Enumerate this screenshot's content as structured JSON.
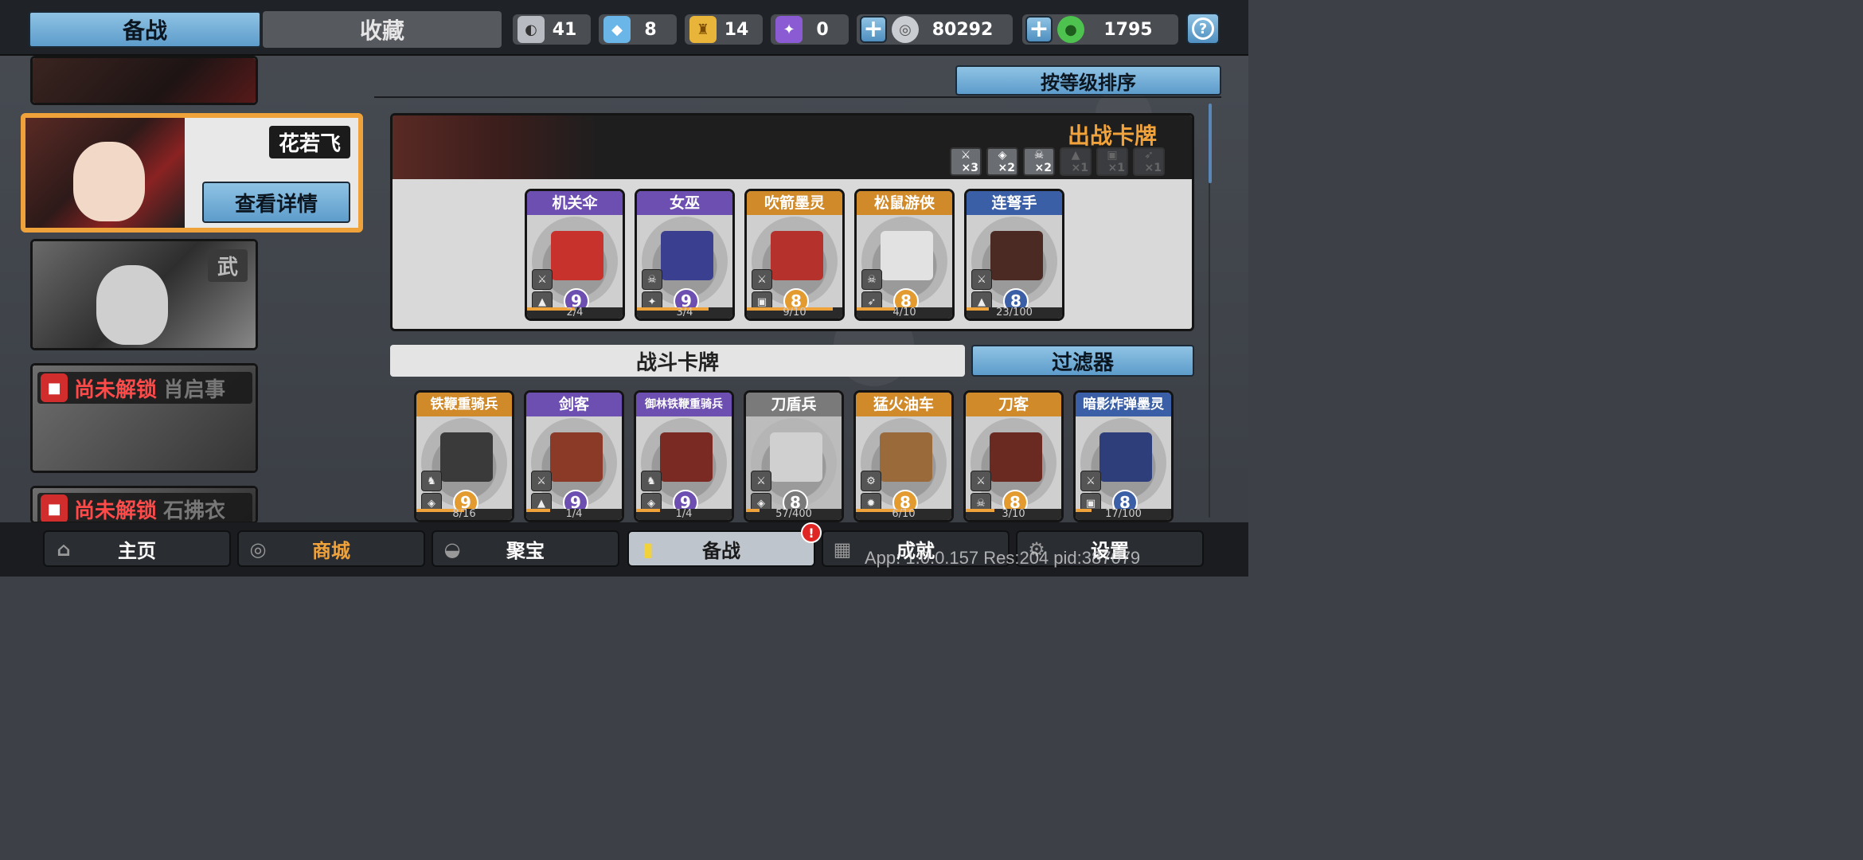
{
  "top_tabs": {
    "main": "备战",
    "collection": "收藏"
  },
  "resources": [
    {
      "icon": "silver-token-icon",
      "value": "41",
      "color": "#b8bcc2"
    },
    {
      "icon": "blue-crystal-icon",
      "value": "8",
      "color": "#6ab6e8"
    },
    {
      "icon": "gold-token-icon",
      "value": "14",
      "color": "#e8b53a"
    },
    {
      "icon": "purple-token-icon",
      "value": "0",
      "color": "#8b5bd3"
    }
  ],
  "coins": "80292",
  "gems": "1795",
  "sort_label": "按等级排序",
  "heroes": [
    {
      "name": "花若飞",
      "selected": true,
      "detail_label": "查看详情"
    },
    {
      "name": "武",
      "selected": false
    },
    {
      "name": "肖启事",
      "locked": true,
      "lock_label": "尚未解锁"
    },
    {
      "name": "石拂衣",
      "locked": true,
      "lock_label": "尚未解锁"
    }
  ],
  "deck": {
    "title": "出战卡牌",
    "limits": [
      {
        "icon": "sword-icon",
        "count": "×3",
        "active": true
      },
      {
        "icon": "shield-icon",
        "count": "×2",
        "active": true
      },
      {
        "icon": "skull-icon",
        "count": "×2",
        "active": true
      },
      {
        "icon": "helmet-icon",
        "count": "×1",
        "active": false
      },
      {
        "icon": "mask-icon",
        "count": "×1",
        "active": false
      },
      {
        "icon": "bow-icon",
        "count": "×1",
        "active": false
      }
    ],
    "cards": [
      {
        "name": "机关伞",
        "level": "9",
        "progress": "2/4",
        "tier": "purple"
      },
      {
        "name": "女巫",
        "level": "9",
        "progress": "3/4",
        "tier": "purple"
      },
      {
        "name": "吹箭墨灵",
        "level": "8",
        "progress": "9/10",
        "tier": "gold"
      },
      {
        "name": "松鼠游侠",
        "level": "8",
        "progress": "4/10",
        "tier": "gold"
      },
      {
        "name": "连弩手",
        "level": "8",
        "progress": "23/100",
        "tier": "blue"
      }
    ]
  },
  "battle": {
    "label": "战斗卡牌",
    "filter_label": "过滤器",
    "cards": [
      {
        "name": "铁鞭重骑兵",
        "level": "9",
        "progress": "8/16",
        "tier": "gold"
      },
      {
        "name": "剑客",
        "level": "9",
        "progress": "1/4",
        "tier": "purple"
      },
      {
        "name": "御林铁鞭重骑兵",
        "level": "9",
        "progress": "1/4",
        "tier": "purple"
      },
      {
        "name": "刀盾兵",
        "level": "8",
        "progress": "57/400",
        "tier": "blue"
      },
      {
        "name": "猛火油车",
        "level": "8",
        "progress": "6/10",
        "tier": "gold"
      },
      {
        "name": "刀客",
        "level": "8",
        "progress": "3/10",
        "tier": "gold"
      },
      {
        "name": "暗影炸弹墨灵",
        "level": "8",
        "progress": "17/100",
        "tier": "blue"
      }
    ]
  },
  "nav": {
    "home": "主页",
    "shop": "商城",
    "treasure": "聚宝",
    "prepare": "备战",
    "achievements": "成就",
    "settings": "设置",
    "prepare_badge": "!"
  },
  "debug_text": "App: 1.0.0.157 Res:204 pid:387079"
}
